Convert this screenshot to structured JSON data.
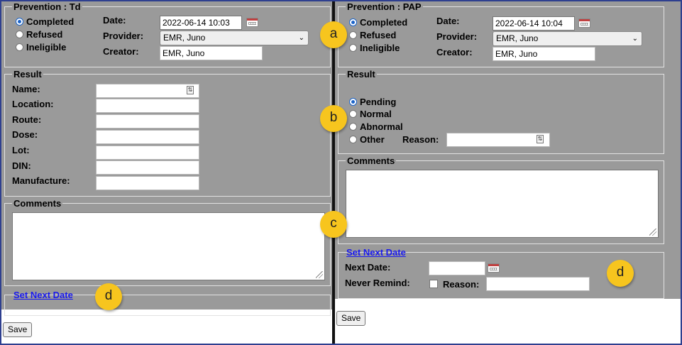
{
  "left": {
    "prevention": {
      "legend": "Prevention : Td",
      "options": [
        "Completed",
        "Refused",
        "Ineligible"
      ],
      "selected": "Completed",
      "date_label": "Date:",
      "date_value": "2022-06-14 10:03",
      "provider_label": "Provider:",
      "provider_value": "EMR, Juno",
      "creator_label": "Creator:",
      "creator_value": "EMR, Juno"
    },
    "result": {
      "legend": "Result",
      "fields": [
        "Name:",
        "Location:",
        "Route:",
        "Dose:",
        "Lot:",
        "DIN:",
        "Manufacture:"
      ]
    },
    "comments": {
      "legend": "Comments"
    },
    "set_next_date": "Set Next Date",
    "save": "Save"
  },
  "right": {
    "prevention": {
      "legend": "Prevention : PAP",
      "options": [
        "Completed",
        "Refused",
        "Ineligible"
      ],
      "selected": "Completed",
      "date_label": "Date:",
      "date_value": "2022-06-14 10:04",
      "provider_label": "Provider:",
      "provider_value": "EMR, Juno",
      "creator_label": "Creator:",
      "creator_value": "EMR, Juno"
    },
    "result": {
      "legend": "Result",
      "options": [
        "Pending",
        "Normal",
        "Abnormal",
        "Other"
      ],
      "selected": "Pending",
      "reason_label": "Reason:"
    },
    "comments": {
      "legend": "Comments"
    },
    "set_next_date": "Set Next Date",
    "next_date_label": "Next Date:",
    "never_remind_label": "Never Remind:",
    "reason_label": "Reason:",
    "save": "Save"
  },
  "callouts": {
    "a": "a",
    "b": "b",
    "c": "c",
    "d1": "d",
    "d2": "d",
    "color": "#f7c51e"
  },
  "colors": {
    "panel": "#9a9a9a",
    "link": "#1a1aee",
    "frame": "#2e3f8f",
    "radio_selected": "#1a63c9"
  }
}
